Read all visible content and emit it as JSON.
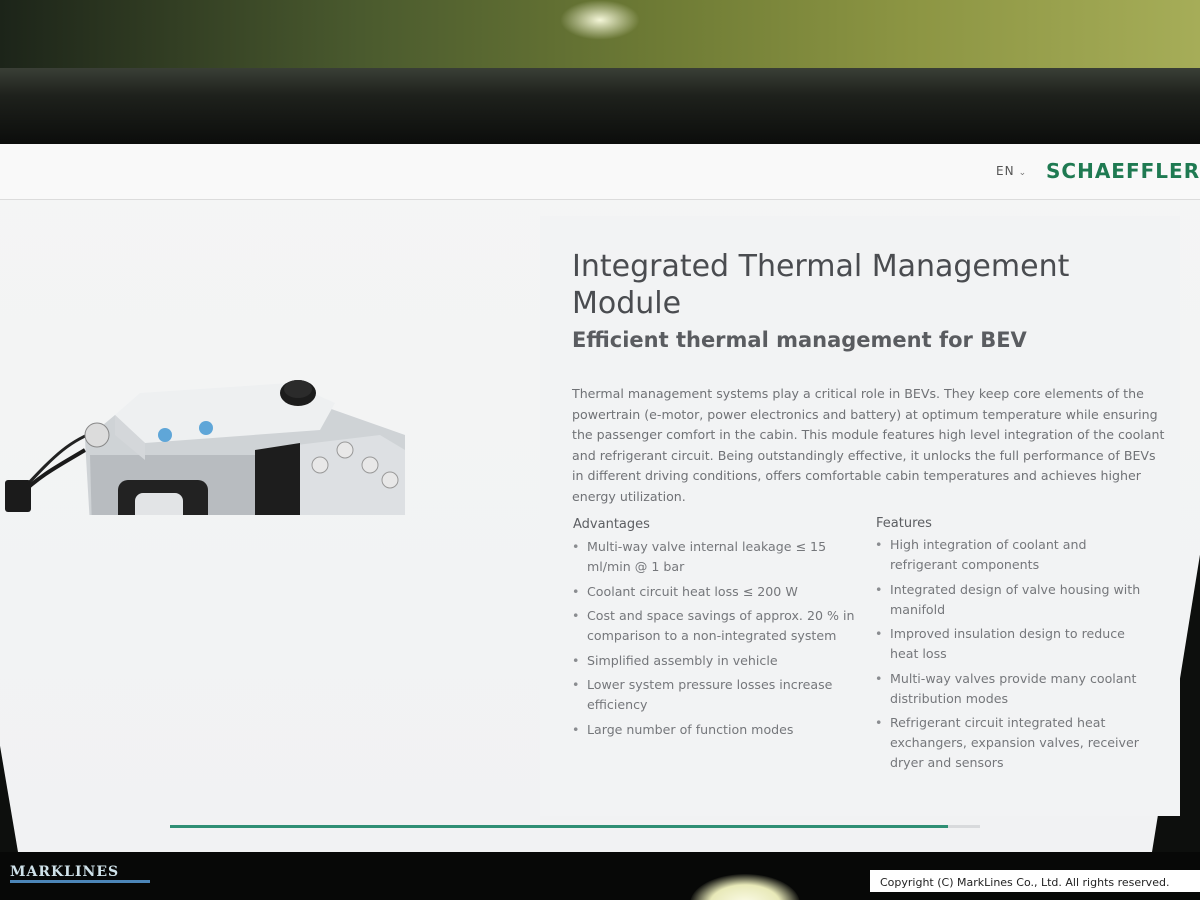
{
  "header": {
    "language": "EN",
    "brand": "SCHAEFFLER"
  },
  "main": {
    "title": "Integrated Thermal Management Module",
    "subtitle": "Efficient thermal management for BEV",
    "intro": "Thermal management systems play a critical role in BEVs. They keep core elements of the powertrain (e-motor, power electronics and battery) at optimum temperature while ensuring the passenger comfort in the cabin. This module features high level integration of the coolant and refrigerant circuit. Being outstandingly effective, it unlocks the full performance of BEVs in different driving conditions, offers comfortable cabin temperatures and achieves higher energy utilization.",
    "advantages": {
      "title": "Advantages",
      "items": [
        "Multi-way valve internal leakage ≤ 15 ml/min @ 1 bar",
        "Coolant circuit heat loss ≤ 200 W",
        "Cost and space savings of approx. 20 % in comparison to a non-integrated system",
        "Simplified assembly in vehicle",
        "Lower system pressure losses increase efficiency",
        "Large number of function modes"
      ]
    },
    "features": {
      "title": "Features",
      "items": [
        "High integration of coolant and refrigerant components",
        "Integrated design of valve housing with manifold",
        "Improved insulation design to reduce heat loss",
        "Multi-way valves provide many coolant distribution modes",
        "Refrigerant circuit integrated heat exchangers, expansion valves, receiver dryer and sensors"
      ]
    }
  },
  "progress": {
    "fraction": 0.96
  },
  "watermark": {
    "logo": "MARKLINES",
    "copyright": "Copyright (C) MarkLines Co., Ltd. All rights reserved."
  },
  "colors": {
    "brand": "#1f7a52",
    "progress": "#2f8f74"
  },
  "icons": {
    "language_dropdown": "chevron-down-icon"
  }
}
